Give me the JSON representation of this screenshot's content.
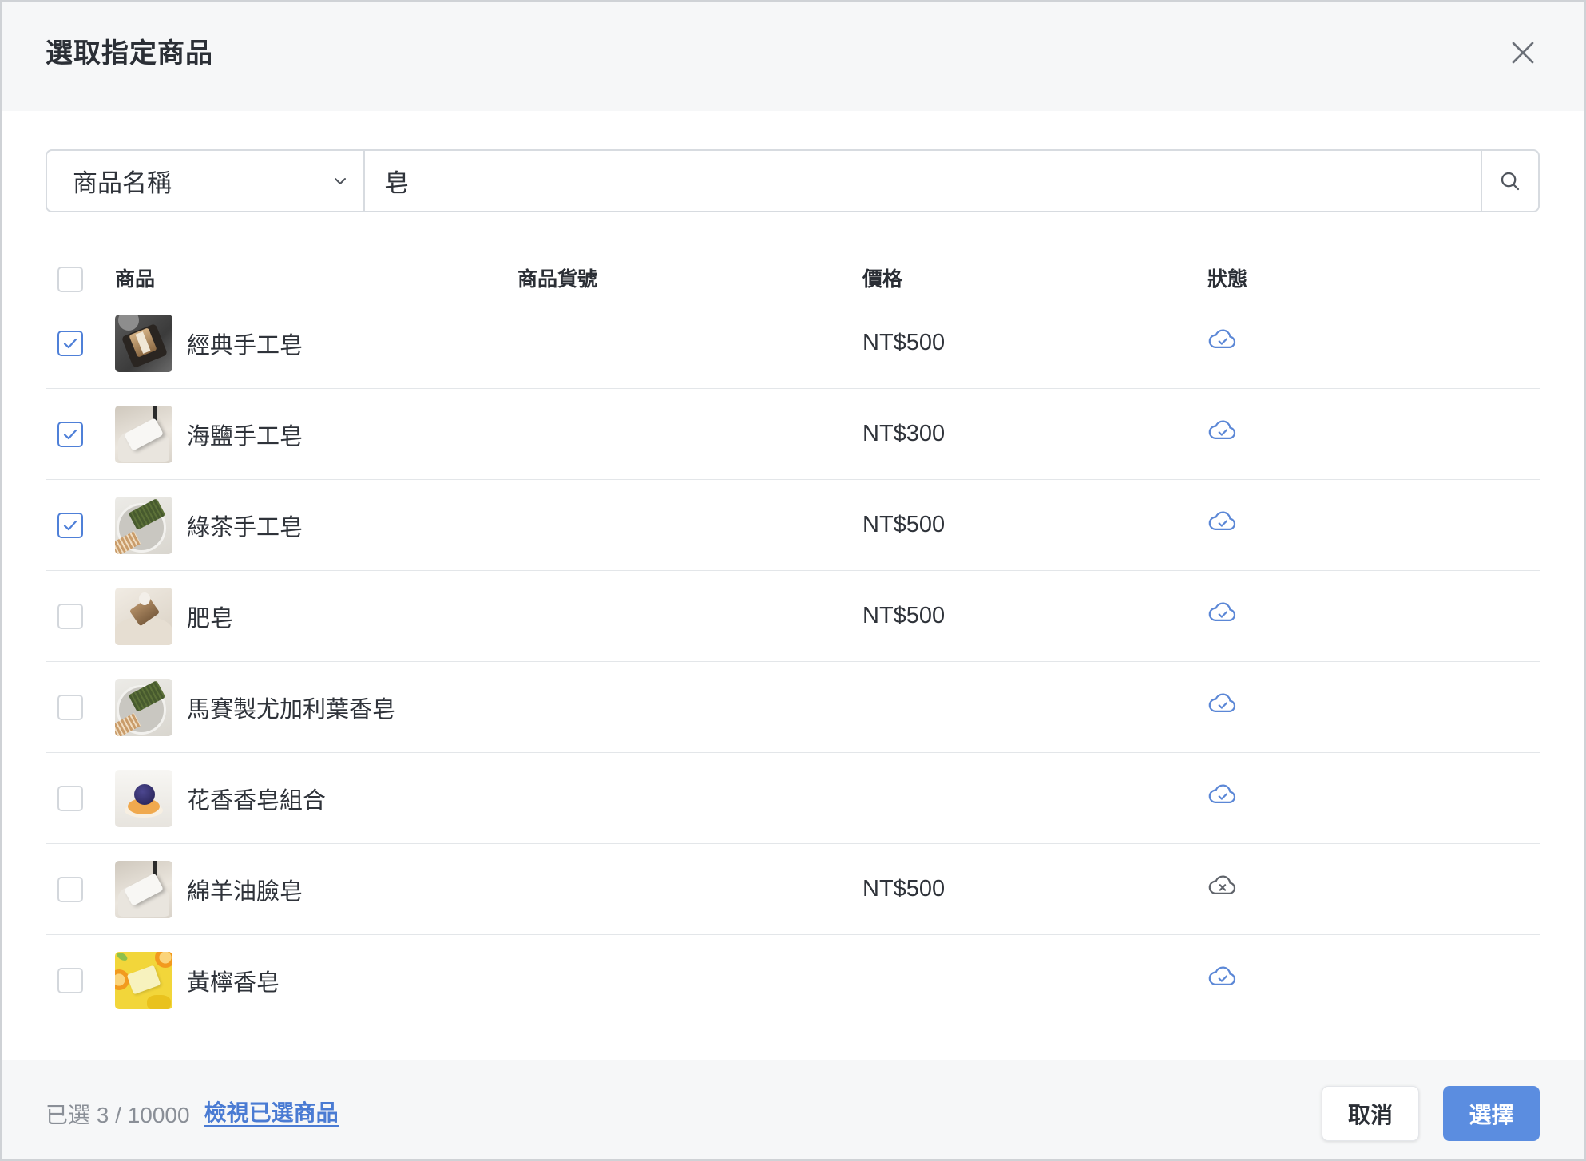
{
  "dialog": {
    "title": "選取指定商品",
    "close_icon": "close-icon"
  },
  "search": {
    "field_selected": "商品名稱",
    "field_icon": "chevron-down-icon",
    "query": "皂",
    "search_icon": "search-icon"
  },
  "table": {
    "select_all_checked": false,
    "headers": {
      "product": "商品",
      "sku": "商品貨號",
      "price": "價格",
      "status": "狀態"
    },
    "rows": [
      {
        "name": "經典手工皂",
        "price": "NT$500",
        "checked": true,
        "status_icon": "cloud-check-icon"
      },
      {
        "name": "海鹽手工皂",
        "price": "NT$300",
        "checked": true,
        "status_icon": "cloud-check-icon"
      },
      {
        "name": "綠茶手工皂",
        "price": "NT$500",
        "checked": true,
        "status_icon": "cloud-check-icon"
      },
      {
        "name": "肥皂",
        "price": "NT$500",
        "checked": false,
        "status_icon": "cloud-check-icon"
      },
      {
        "name": "馬賽製尤加利葉香皂",
        "checked": false,
        "status_icon": "cloud-check-icon"
      },
      {
        "name": "花香香皂組合",
        "checked": false,
        "status_icon": "cloud-check-icon"
      },
      {
        "name": "綿羊油臉皂",
        "price": "NT$500",
        "checked": false,
        "status_icon": "cloud-x-icon"
      },
      {
        "name": "黃檸香皂",
        "checked": false,
        "status_icon": "cloud-check-icon"
      }
    ]
  },
  "footer": {
    "selected_text": "已選 3 / 10000",
    "view_selected_link": "檢視已選商品",
    "cancel_label": "取消",
    "select_label": "選擇"
  },
  "colors": {
    "accent": "#5b8de0",
    "link": "#4a7bd3",
    "checkbox_checked": "#4f80d8",
    "status_ok": "#5b87d6",
    "status_off": "#5f636a"
  }
}
